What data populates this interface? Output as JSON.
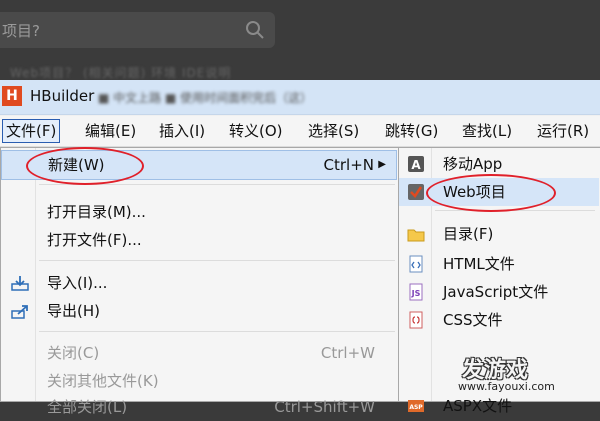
{
  "background": {
    "search_text": "项目?",
    "blurred_text": "Web项目？ (相关问题) 环境 IDE说明"
  },
  "window": {
    "app_logo": "H",
    "title": "HBuilder",
    "title_blur": "■ 中文上路   ■ 使用时间面积完后（这）"
  },
  "menubar": [
    {
      "label": "文件(F)",
      "active": true
    },
    {
      "label": "编辑(E)"
    },
    {
      "label": "插入(I)"
    },
    {
      "label": "转义(O)"
    },
    {
      "label": "选择(S)"
    },
    {
      "label": "跳转(G)"
    },
    {
      "label": "查找(L)"
    },
    {
      "label": "运行(R)"
    }
  ],
  "file_menu": {
    "new": {
      "label": "新建(W)",
      "shortcut": "Ctrl+N"
    },
    "open_dir": {
      "label": "打开目录(M)..."
    },
    "open_file": {
      "label": "打开文件(F)..."
    },
    "import": {
      "label": "导入(I)..."
    },
    "export": {
      "label": "导出(H)"
    },
    "close": {
      "label": "关闭(C)",
      "shortcut": "Ctrl+W"
    },
    "close_others": {
      "label": "关闭其他文件(K)"
    },
    "close_all": {
      "label": "全部关闭(L)",
      "shortcut": "Ctrl+Shift+W"
    }
  },
  "new_submenu": [
    {
      "label": "移动App",
      "icon": "mobile-app-icon"
    },
    {
      "label": "Web项目",
      "icon": "web-project-icon"
    },
    {
      "label": "目录(F)",
      "icon": "folder-icon"
    },
    {
      "label": "HTML文件",
      "icon": "html-file-icon"
    },
    {
      "label": "JavaScript文件",
      "icon": "js-file-icon"
    },
    {
      "label": "CSS文件",
      "icon": "css-file-icon"
    },
    {
      "label": "ASPX文件",
      "icon": "aspx-file-icon"
    }
  ],
  "watermark": {
    "main": "发游戏",
    "url": "www.fayouxi.com"
  },
  "colors": {
    "highlight": "#d5e5f8",
    "annotation_red": "#e0202a",
    "logo": "#e04a1f"
  }
}
